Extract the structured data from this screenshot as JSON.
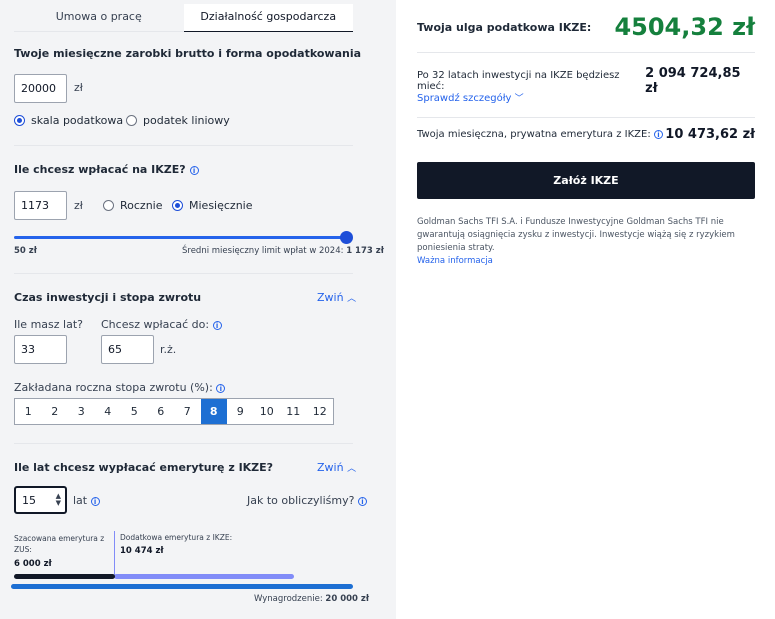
{
  "tabs": [
    {
      "label": "Umowa o pracę"
    },
    {
      "label": "Działalność gospodarcza"
    }
  ],
  "earnings": {
    "heading": "Twoje miesięczne zarobki brutto i forma opodatkowania",
    "value": "20000",
    "unit": "zł",
    "tax_options": [
      "skala podatkowa",
      "podatek liniowy"
    ],
    "selected_tax": "skala podatkowa"
  },
  "ikze_payment": {
    "heading": "Ile chcesz wpłacać na IKZE?",
    "value": "1173",
    "unit": "zł",
    "frequency_options": [
      "Rocznie",
      "Miesięcznie"
    ],
    "selected_frequency": "Miesięcznie",
    "slider_min_label": "50 zł",
    "slider_max_label": "Średni miesięczny limit wpłat w 2024:",
    "slider_max_value": "1 173 zł",
    "slider_fraction": 1.0
  },
  "investment": {
    "heading": "Czas inwestycji i stopa zwrotu",
    "collapse_label": "Zwiń",
    "age_label": "Ile masz lat?",
    "age_value": "33",
    "payout_label": "Chcesz wpłacać do:",
    "payout_value": "65",
    "payout_unit": "r.ż.",
    "rate_label": "Zakładana roczna stopa zwrotu (%):",
    "rates": [
      "1",
      "2",
      "3",
      "4",
      "5",
      "6",
      "7",
      "8",
      "9",
      "10",
      "11",
      "12"
    ],
    "selected_rate": "8"
  },
  "pension": {
    "heading": "Ile lat chcesz wypłacać emeryturę z IKZE?",
    "collapse_label": "Zwiń",
    "years_value": "15",
    "years_unit": "lat",
    "how_calculated": "Jak to obliczyliśmy?",
    "zus_label_1": "Szacowana emerytura z",
    "zus_label_2": "ZUS:",
    "zus_value": "6 000 zł",
    "ikze_label": "Dodatkowa emerytura z IKZE:",
    "ikze_value": "10 474 zł",
    "salary_label": "Wynagrodzenie:",
    "salary_value": "20 000 zł",
    "colors": {
      "zus": "#111827",
      "ikze": "#818cf8",
      "salary": "#1d6fd3"
    }
  },
  "summary": {
    "tax_relief_label": "Twoja ulga podatkowa IKZE:",
    "tax_relief_value": "4504,32 zł",
    "after_years_label": "Po 32 latach inwestycji na IKZE będziesz mieć:",
    "after_years_value": "2 094 724,85 zł",
    "details_link": "Sprawdź szczegóły",
    "monthly_pension_label": "Twoja miesięczna, prywatna emerytura z IKZE:",
    "monthly_pension_value": "10 473,62 zł",
    "cta_label": "Załóż IKZE",
    "disclaimer": "Goldman Sachs TFI S.A. i Fundusze Inwestycyjne Goldman Sachs TFI nie gwarantują osiągnięcia zysku z inwestycji. Inwestycje wiążą się z ryzykiem poniesienia straty.",
    "important_link": "Ważna informacja",
    "accent_green": "#15803d"
  }
}
